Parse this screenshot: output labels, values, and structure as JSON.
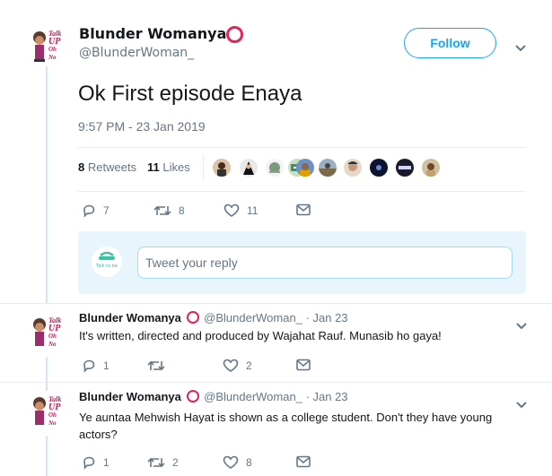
{
  "main_tweet": {
    "display_name": "Blunder Womanya",
    "handle": "@BlunderWoman_",
    "follow_label": "Follow",
    "text": "Ok First episode Enaya",
    "timestamp": "9:57 PM - 23 Jan 2019",
    "retweet_count": "8",
    "retweet_label": "Retweets",
    "like_count": "11",
    "like_label": "Likes",
    "reply_action_count": "7",
    "retweet_action_count": "8",
    "like_action_count": "11",
    "avatar_label": [
      "Talk",
      "UP",
      "Oh No"
    ]
  },
  "reply_composer": {
    "placeholder": "Tweet your reply",
    "avatar_label": "Talk to be"
  },
  "replies": [
    {
      "display_name": "Blunder Womanya",
      "handle": "@BlunderWoman_",
      "date": "· Jan 23",
      "text": "It's written, directed and produced by Wajahat Rauf. Munasib ho gaya!",
      "reply_count": "1",
      "retweet_count": "",
      "like_count": "2"
    },
    {
      "display_name": "Blunder Womanya",
      "handle": "@BlunderWoman_",
      "date": "· Jan 23",
      "text_line1": "Ye auntaa Mehwish Hayat is shown as a college student. Don't they have young",
      "text_line2": "actors?",
      "reply_count": "1",
      "retweet_count": "2",
      "like_count": "8"
    }
  ],
  "colors": {
    "accent": "#1da1f2",
    "muted": "#657786",
    "thread_line": "#cce7ff",
    "badge_red": "#e0245e"
  }
}
